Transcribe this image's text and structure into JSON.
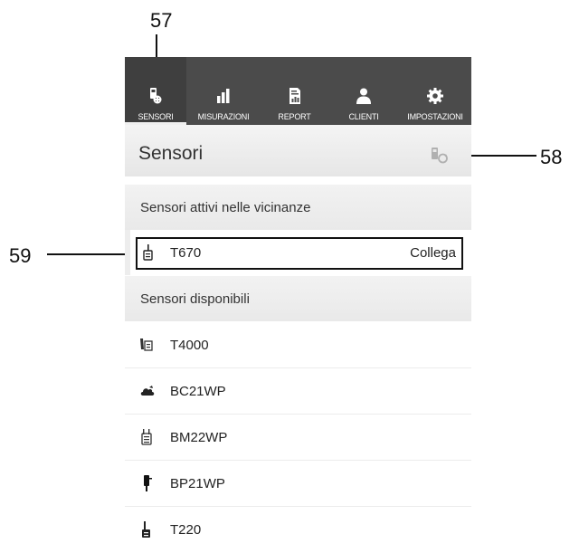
{
  "callouts": {
    "c57": "57",
    "c58": "58",
    "c59": "59"
  },
  "nav": [
    {
      "label": "SENSORI",
      "icon": "sensor-icon",
      "active": true
    },
    {
      "label": "MISURAZIONI",
      "icon": "bar-chart-icon",
      "active": false
    },
    {
      "label": "REPORT",
      "icon": "report-icon",
      "active": false
    },
    {
      "label": "CLIENTI",
      "icon": "user-icon",
      "active": false
    },
    {
      "label": "IMPOSTAZIONI",
      "icon": "gear-icon",
      "active": false
    }
  ],
  "header": {
    "title": "Sensori",
    "action_icon": "sensor-sync-icon"
  },
  "nearby": {
    "title": "Sensori attivi nelle vicinanze",
    "items": [
      {
        "name": "T670",
        "action": "Collega",
        "icon": "probe-icon"
      }
    ]
  },
  "available": {
    "title": "Sensori disponibili",
    "items": [
      {
        "name": "T4000",
        "icon": "handheld-probe-icon"
      },
      {
        "name": "BC21WP",
        "icon": "cloud-sensor-icon"
      },
      {
        "name": "BM22WP",
        "icon": "manometer-icon"
      },
      {
        "name": "BP21WP",
        "icon": "pressure-probe-icon"
      },
      {
        "name": "T220",
        "icon": "thermometer-icon"
      }
    ]
  }
}
